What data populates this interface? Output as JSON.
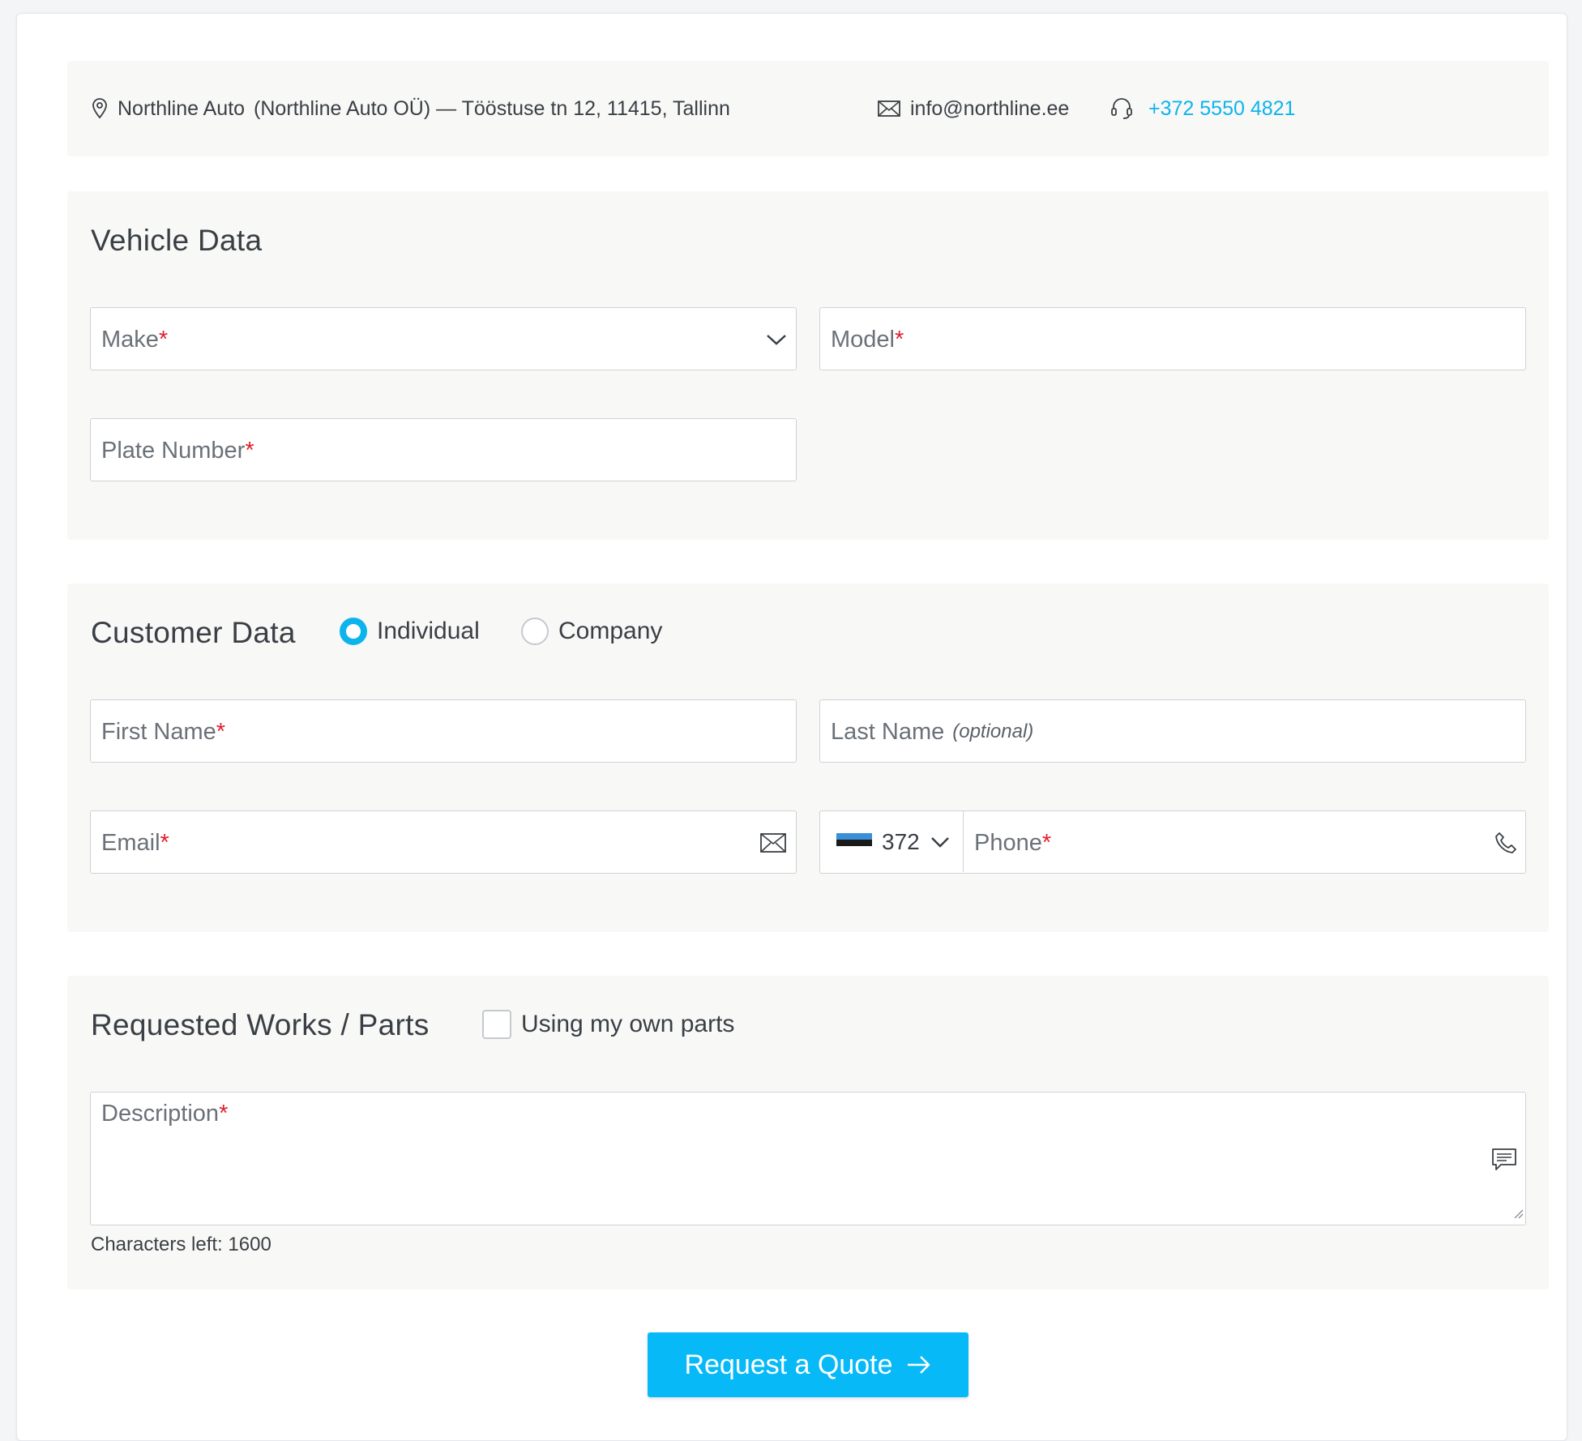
{
  "contact": {
    "company": "Northline Auto",
    "legal_address": "(Northline Auto OÜ) — Tööstuse tn 12, 11415, Tallinn",
    "email": "info@northline.ee",
    "phone": "+372 5550 4821"
  },
  "vehicle": {
    "title": "Vehicle Data",
    "make_placeholder": "Make",
    "model_placeholder": "Model",
    "plate_placeholder": "Plate Number"
  },
  "customer": {
    "title": "Customer Data",
    "type_options": [
      "Individual",
      "Company"
    ],
    "selected_type": "Individual",
    "first_name_placeholder": "First Name",
    "last_name_placeholder": "Last Name",
    "last_name_hint": "(optional)",
    "email_placeholder": "Email",
    "country_code": "372",
    "phone_placeholder": "Phone"
  },
  "works": {
    "title": "Requested Works / Parts",
    "own_parts_label": "Using my own parts",
    "own_parts_checked": false,
    "description_placeholder": "Description",
    "chars_left_label": "Characters left: 1600"
  },
  "required_mark": "*",
  "submit_label": "Request a Quote",
  "colors": {
    "accent": "#0db4ec",
    "button": "#08b9f8",
    "required": "#e0212f"
  },
  "icons": [
    "location-pin-icon",
    "envelope-icon",
    "headset-icon",
    "chevron-down-icon",
    "phone-icon",
    "comment-icon",
    "arrow-right-icon",
    "estonia-flag-icon"
  ]
}
